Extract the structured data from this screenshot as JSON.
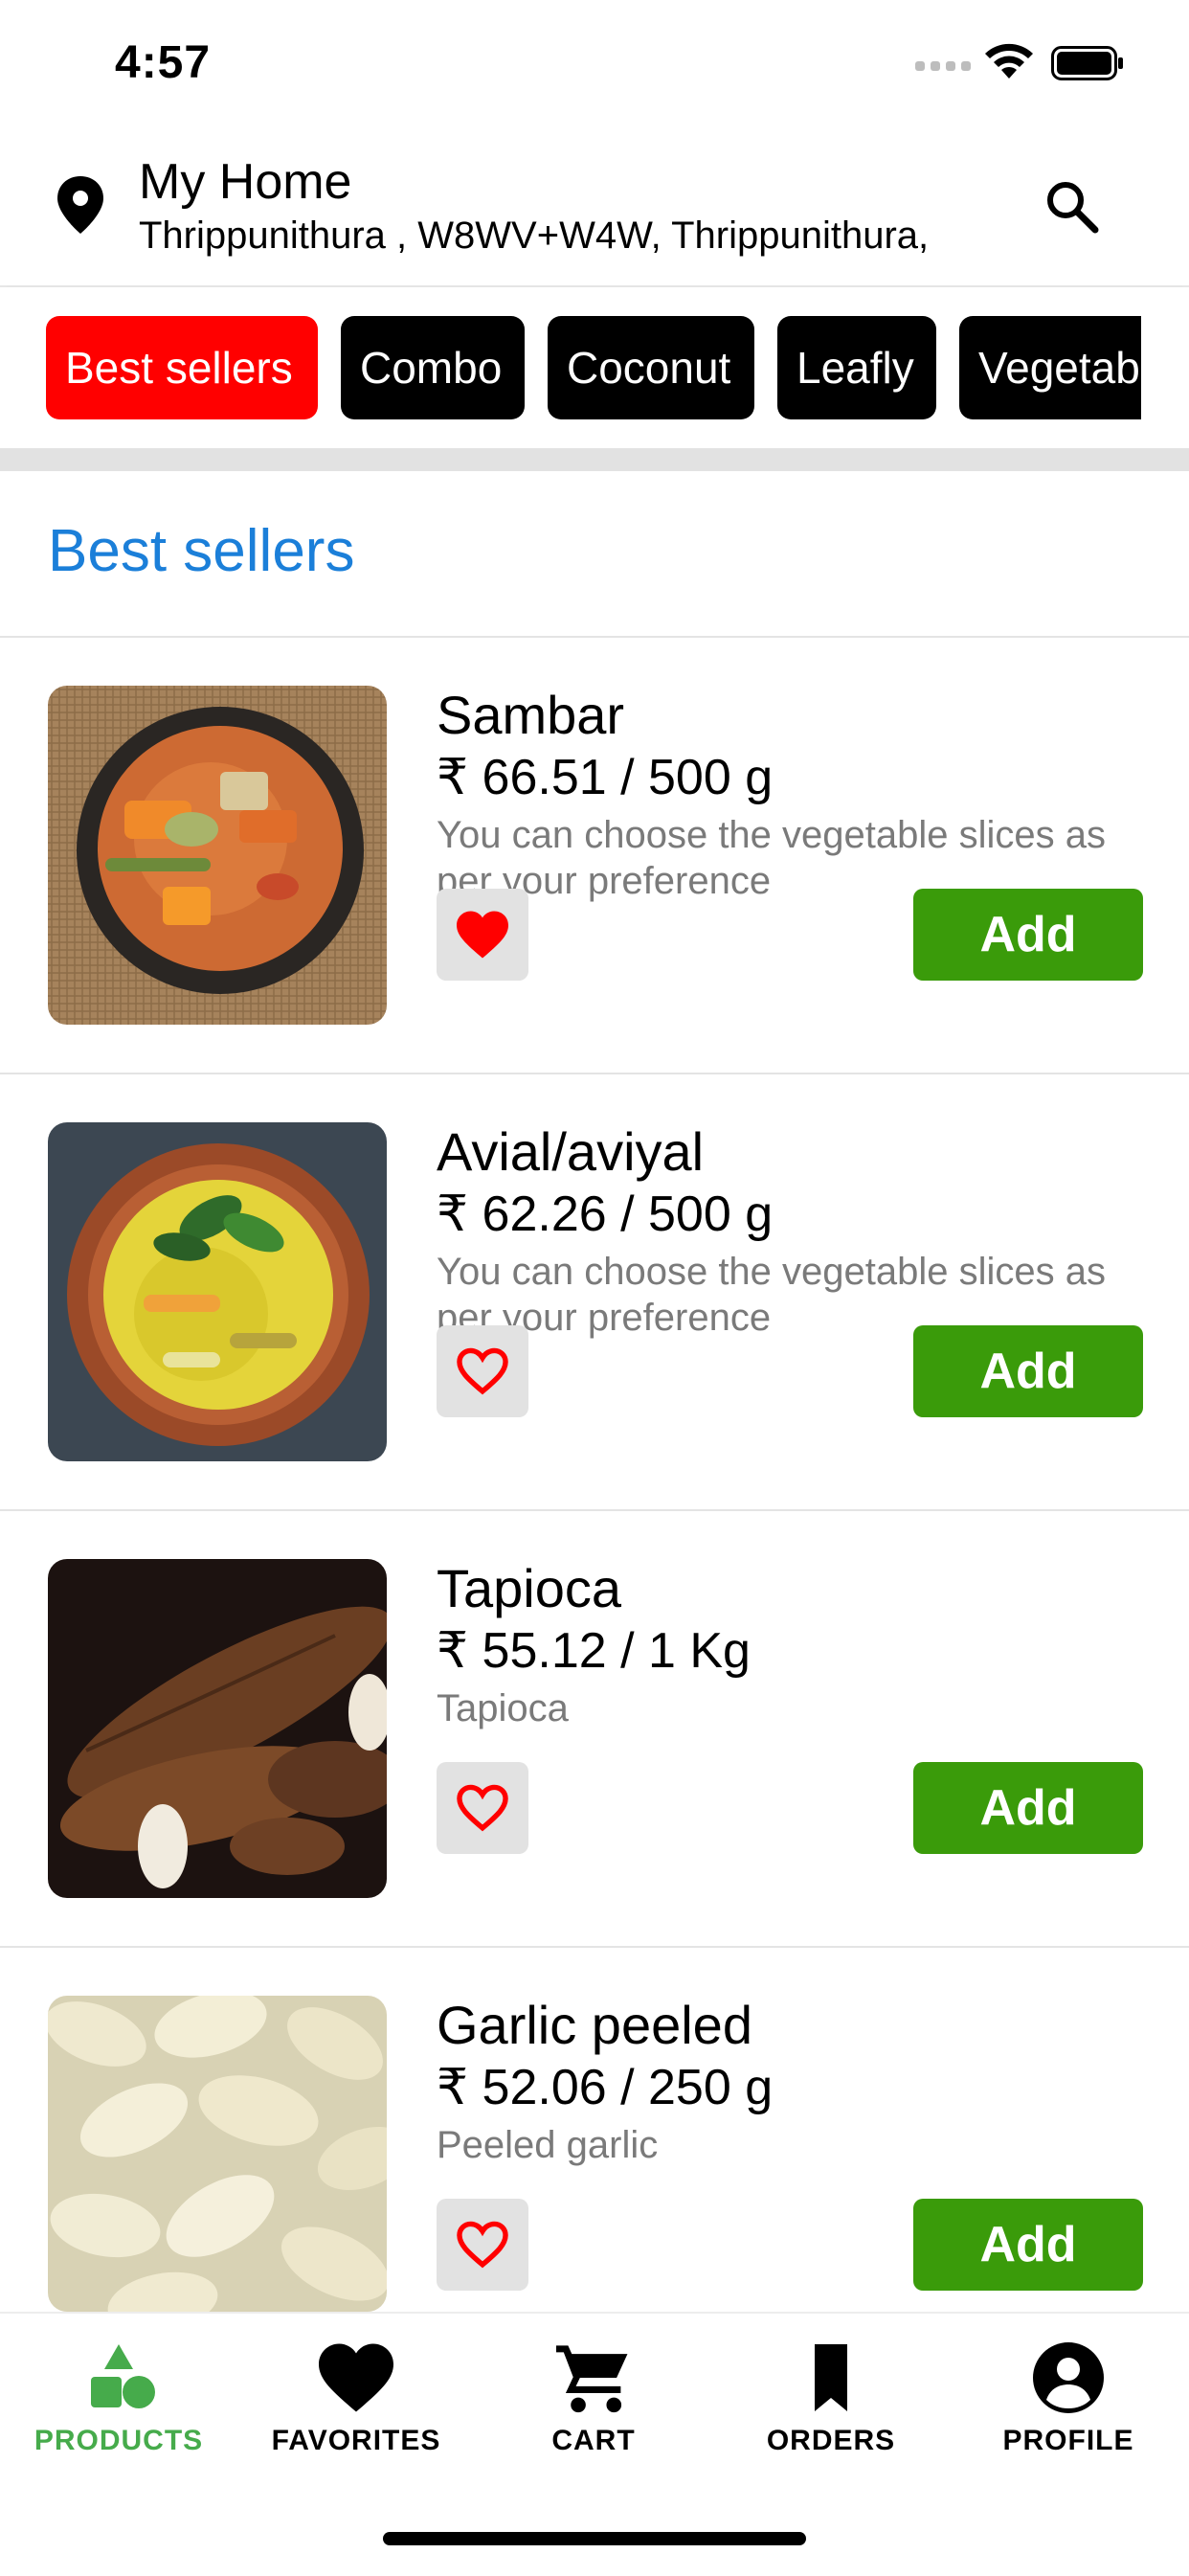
{
  "status_bar": {
    "time": "4:57"
  },
  "location": {
    "title": "My Home",
    "address": "Thrippunithura , W8WV+W4W, Thrippunithura,"
  },
  "categories": [
    "Best sellers",
    "Combo",
    "Coconut",
    "Leafly",
    "Vegetab"
  ],
  "active_category": "Best sellers",
  "section_title": "Best sellers",
  "products": [
    {
      "name": "Sambar",
      "price": "₹ 66.51 / 500 g",
      "description": "You can choose the vegetable slices as per your preference",
      "favorited": true,
      "add_label": "Add"
    },
    {
      "name": "Avial/aviyal",
      "price": "₹ 62.26 / 500 g",
      "description": "You can choose the vegetable slices as per your preference",
      "favorited": false,
      "add_label": "Add"
    },
    {
      "name": "Tapioca",
      "price": "₹ 55.12 / 1 Kg",
      "description": "Tapioca",
      "favorited": false,
      "add_label": "Add"
    },
    {
      "name": "Garlic peeled",
      "price": "₹ 52.06 / 250 g",
      "description": "Peeled garlic",
      "favorited": false,
      "add_label": "Add"
    }
  ],
  "tabs": [
    {
      "label": "PRODUCTS",
      "icon": "products-icon",
      "active": true
    },
    {
      "label": "FAVORITES",
      "icon": "heart-icon",
      "active": false
    },
    {
      "label": "CART",
      "icon": "cart-icon",
      "active": false
    },
    {
      "label": "ORDERS",
      "icon": "bookmark-icon",
      "active": false
    },
    {
      "label": "PROFILE",
      "icon": "profile-icon",
      "active": false
    }
  ],
  "colors": {
    "active_chip": "#ff0000",
    "chip": "#000000",
    "section_title": "#1b7fd9",
    "add_button": "#3a9b0a",
    "favorite_heart": "#ff0000",
    "active_tab": "#46ab4b"
  }
}
